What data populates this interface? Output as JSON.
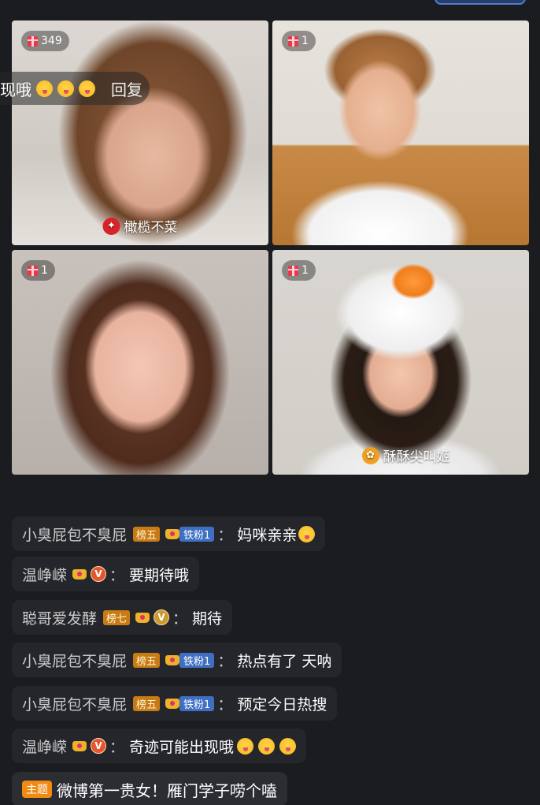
{
  "tiles": [
    {
      "gift_count": "349",
      "name": "橄榄不菜"
    },
    {
      "gift_count": "1"
    },
    {
      "gift_count": "1"
    },
    {
      "gift_count": "1",
      "name": "酥酥尖叫姬"
    }
  ],
  "floating_message": {
    "text": "现哦",
    "reply_label": "回复"
  },
  "chat": [
    {
      "user": "小臭屁包不臭屁",
      "rank": "榜五",
      "fan_badge": "铁粉1",
      "text": "妈咪亲亲"
    },
    {
      "user": "温峥嵘",
      "text": "要期待哦"
    },
    {
      "user": "聪哥爱发酵",
      "rank": "榜七",
      "text": "期待"
    },
    {
      "user": "小臭屁包不臭屁",
      "rank": "榜五",
      "fan_badge": "铁粉1",
      "text": "热点有了 天呐"
    },
    {
      "user": "小臭屁包不臭屁",
      "rank": "榜五",
      "fan_badge": "铁粉1",
      "text": "预定今日热搜"
    },
    {
      "user": "温峥嵘",
      "text": "奇迹可能出现哦"
    }
  ],
  "topic": {
    "badge": "主题",
    "text": "微博第一贵女！雁门学子唠个嗑"
  },
  "colon": "："
}
